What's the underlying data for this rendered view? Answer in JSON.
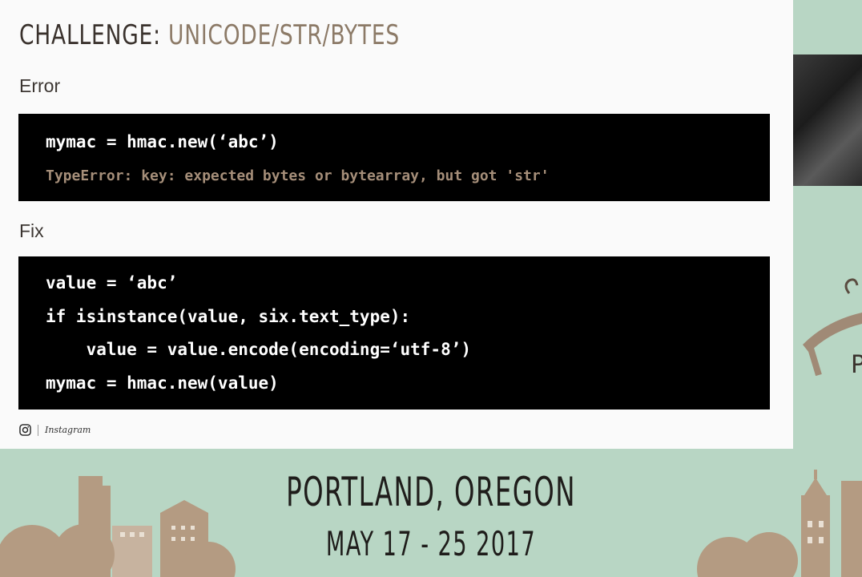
{
  "slide": {
    "title_prefix": "CHALLENGE:",
    "title_topic": "UNICODE/STR/BYTES",
    "error_label": "Error",
    "error_code": {
      "line1": "mymac = hmac.new(‘abc’)",
      "line2": "TypeError: key: expected bytes or bytearray, but got 'str'"
    },
    "fix_label": "Fix",
    "fix_code": {
      "line1": "value = ‘abc’",
      "line2": "if isinstance(value, six.text_type):",
      "line3": "    value = value.encode(encoding=‘utf-8’)",
      "line4": "mymac = hmac.new(value)"
    },
    "footer": {
      "icon": "instagram-icon",
      "label": "Instagram"
    }
  },
  "banner": {
    "title": "PORTLAND, OREGON",
    "dates": "MAY 17 - 25 2017",
    "logo_letter": "P"
  },
  "colors": {
    "slide_bg": "#fafafa",
    "code_bg": "#000000",
    "code_text": "#ffffff",
    "error_text": "#a58e79",
    "title_dark": "#3a322d",
    "title_accent": "#8c7a67",
    "banner_bg": "#b8d6c4",
    "skyline": "#b49b82"
  }
}
